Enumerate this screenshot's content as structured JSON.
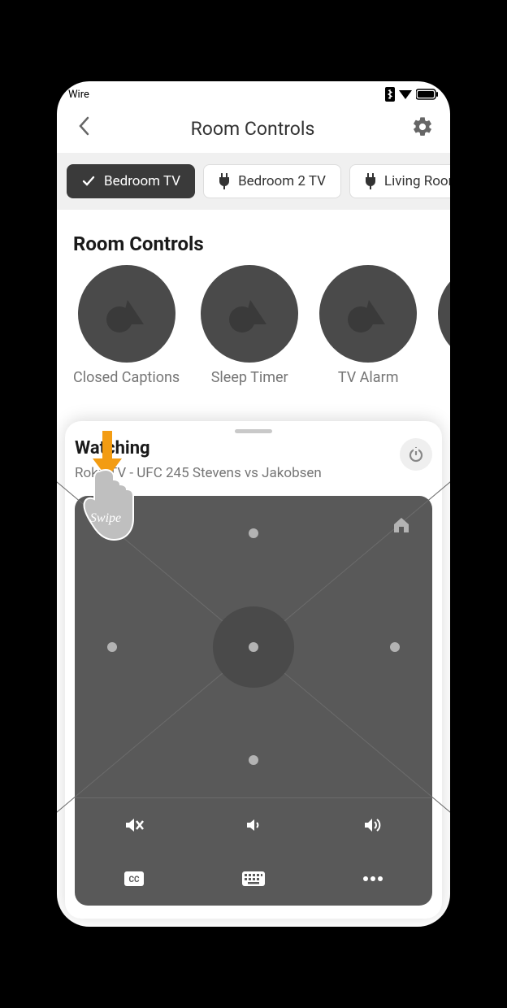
{
  "status": {
    "carrier": "Wire"
  },
  "nav": {
    "title": "Room Controls"
  },
  "rooms": [
    {
      "label": "Bedroom TV",
      "active": true
    },
    {
      "label": "Bedroom 2 TV",
      "active": false
    },
    {
      "label": "Living Room",
      "active": false
    }
  ],
  "section": {
    "title": "Room Controls"
  },
  "controls": [
    {
      "label": "Closed Captions"
    },
    {
      "label": "Sleep Timer"
    },
    {
      "label": "TV Alarm"
    }
  ],
  "watching": {
    "title": "Watching",
    "subtitle": "Roku TV - UFC 245 Stevens vs Jakobsen"
  },
  "overlay": {
    "swipe_label": "Swipe"
  }
}
